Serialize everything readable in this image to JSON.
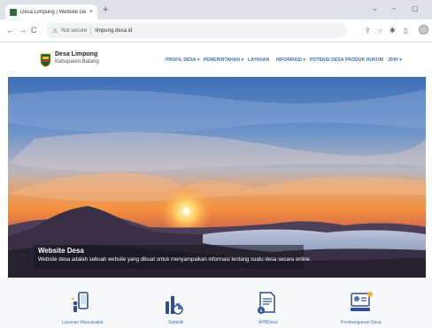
{
  "browser": {
    "tab_title": "Desa Limpung | Website Desa Li",
    "tab_close": "×",
    "new_tab": "+",
    "window_controls": [
      "⌄",
      "–",
      "▢"
    ],
    "nav": {
      "back": "←",
      "forward": "→",
      "reload": "C"
    },
    "security_label": "Not secure",
    "url": "limpung.desa.id",
    "toolbar_icons": [
      "share-icon",
      "star-icon",
      "extension-icon",
      "sidepanel-icon",
      "profile-avatar"
    ]
  },
  "site": {
    "brand_name": "Desa Limpung",
    "brand_sub": "Kabupaten Batang",
    "nav_items": [
      {
        "label": "PROFIL DESA ▾"
      },
      {
        "label": "PEMERINTAHAN ▾"
      },
      {
        "label": "LAYANAN"
      },
      {
        "label": "INFORMASI ▾"
      },
      {
        "label": "POTENSI DESA"
      },
      {
        "label": "PRODUK HUKUM"
      },
      {
        "label": "JDIH ▾"
      }
    ]
  },
  "hero": {
    "title": "Website Desa",
    "description": "Website desa adalah sebuah website yang dibuat untuk menyampaikan informasi tentang suatu desa secara online."
  },
  "features": [
    {
      "label": "Layanan Masyarakat",
      "icon": "service-icon"
    },
    {
      "label": "Statistik",
      "icon": "statistics-icon"
    },
    {
      "label": "APBDesa",
      "icon": "budget-icon"
    },
    {
      "label": "Pembangunan Desa",
      "icon": "development-icon"
    }
  ],
  "colors": {
    "nav_accent": "#3b6fb6",
    "feature_icon": "#2f4f8f"
  }
}
